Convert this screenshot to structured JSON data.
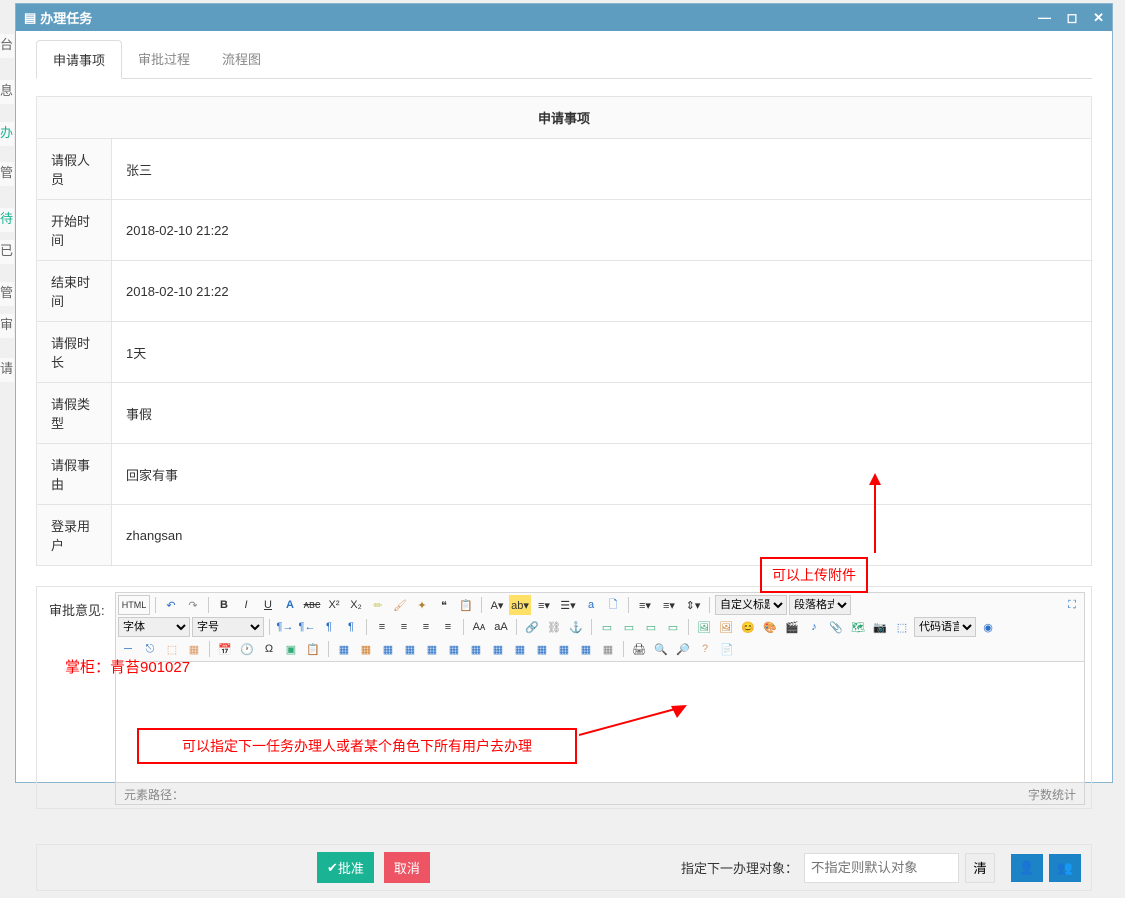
{
  "window_title": "办理任务",
  "tabs": [
    {
      "label": "申请事项",
      "active": true
    },
    {
      "label": "审批过程",
      "active": false
    },
    {
      "label": "流程图",
      "active": false
    }
  ],
  "application": {
    "section_title": "申请事项",
    "fields": [
      {
        "label": "请假人员",
        "value": "张三"
      },
      {
        "label": "开始时间",
        "value": "2018-02-10 21:22"
      },
      {
        "label": "结束时间",
        "value": "2018-02-10 21:22"
      },
      {
        "label": "请假时长",
        "value": "1天"
      },
      {
        "label": "请假类型",
        "value": "事假"
      },
      {
        "label": "请假事由",
        "value": "回家有事"
      },
      {
        "label": "登录用户",
        "value": "zhangsan"
      }
    ]
  },
  "review_label": "审批意见:",
  "editor": {
    "html_btn": "HTML",
    "custom_title": "自定义标题",
    "paragraph": "段落格式",
    "font": "字体",
    "size": "字号",
    "code_lang": "代码语言",
    "path_label": "元素路径：",
    "word_count": "字数统计"
  },
  "footer": {
    "approve": "批准",
    "cancel": "取消",
    "next_label": "指定下一办理对象：",
    "placeholder": "不指定则默认对象",
    "clear": "清"
  },
  "annotations": {
    "upload": "可以上传附件",
    "assign": "可以指定下一任务办理人或者某个角色下所有用户去办理",
    "watermark": "掌柜：青苔901027"
  }
}
